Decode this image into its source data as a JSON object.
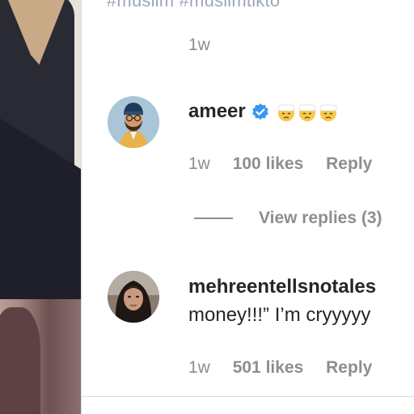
{
  "post": {
    "hashtags_text": "#muslim #muslimtikto",
    "caption_time": "1w"
  },
  "comments": [
    {
      "username": "ameer",
      "verified": true,
      "text": "",
      "emojis": [
        "face-with-head-bandage",
        "face-with-head-bandage",
        "face-with-head-bandage"
      ],
      "time": "1w",
      "likes": "100 likes",
      "reply": "Reply",
      "view_replies": "View replies (3)"
    },
    {
      "username": "mehreentellsnotales",
      "verified": false,
      "text": "money!!!” I’m cryyyyy",
      "time": "1w",
      "likes": "501 likes",
      "reply": "Reply"
    }
  ],
  "colors": {
    "text_primary": "#262626",
    "text_secondary": "#8e8e8e",
    "verified_blue": "#3897f0",
    "hashtag": "#9aa6b8"
  }
}
